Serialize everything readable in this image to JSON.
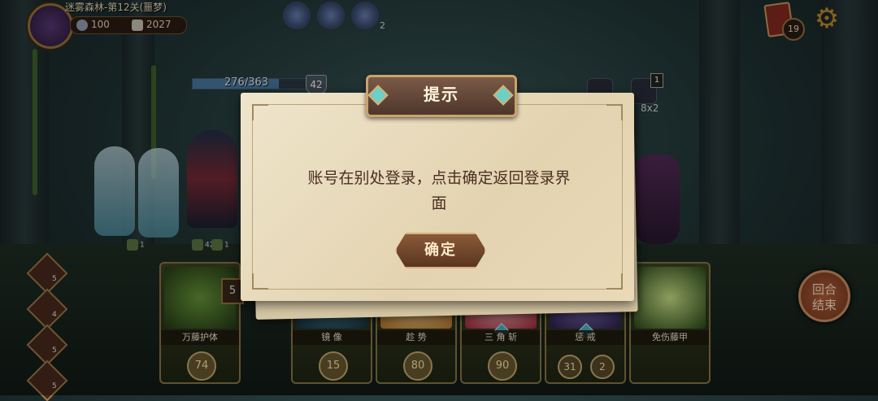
{
  "hud": {
    "stage_title": "迷雾森林-第12关(噩梦)",
    "resource_1": "100",
    "resource_2": "2027",
    "orb_count": "2",
    "deck_count": "19"
  },
  "battle": {
    "hp_text": "276/363",
    "hp_fraction": 0.76,
    "armor": "42",
    "enemy_badge": "1",
    "enemy_multiplier": "8x2",
    "stat_1": "1",
    "stat_2": "42",
    "stat_3": "1",
    "party_counts": [
      "5",
      "4",
      "5",
      "5"
    ],
    "draw_pile": "5"
  },
  "cards": [
    {
      "name": "万藤护体",
      "cost": "74",
      "color": "#3e6a2a"
    },
    {
      "name": "镜 像",
      "cost": "15",
      "color": "#2a5a6a"
    },
    {
      "name": "趁 势",
      "cost": "80",
      "color": "#d0a040"
    },
    {
      "name": "三 角 斩",
      "cost": "90",
      "color": "#a8283a"
    },
    {
      "name": "惩 戒",
      "cost": "31",
      "cost2": "2",
      "color": "#4a3a7a"
    },
    {
      "name": "免伤藤甲",
      "cost": "",
      "color": "#5a8a2a"
    }
  ],
  "end_turn": {
    "label_1": "回合",
    "label_2": "结束"
  },
  "dialog": {
    "title": "提示",
    "message_line1": "账号在别处登录，点击确定返回登录界",
    "message_line2": "面",
    "ok_label": "确定"
  },
  "colors": {
    "accent": "#c9a36a",
    "paper": "#e8dcbc",
    "text": "#4a2f22"
  }
}
